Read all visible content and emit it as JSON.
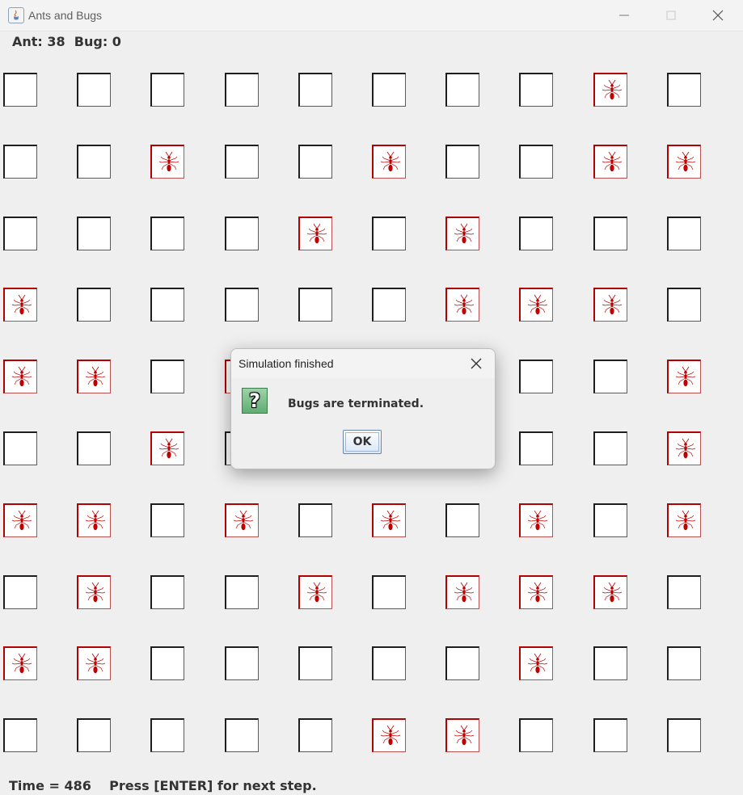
{
  "window": {
    "title": "Ants and Bugs",
    "icons": {
      "app": "java-icon",
      "minimize": "minimize-icon",
      "maximize": "maximize-icon",
      "close": "close-icon"
    }
  },
  "status": {
    "score": "Ant: 38  Bug: 0",
    "footer": "Time = 486    Press [ENTER] for next step."
  },
  "board": {
    "legend": {
      "A": "ant",
      ".": "empty"
    },
    "rows": [
      "........A.",
      "..A..A..AA",
      "....A.A...",
      "A.....AAA.",
      "AA.A.....A",
      "..A......A",
      "AA.A.A.A.A",
      ".A..A.AAA.",
      "AA.....A..",
      ".....AA..."
    ]
  },
  "dialog": {
    "title": "Simulation finished",
    "message": "Bugs are terminated.",
    "icon": "question-icon",
    "icon_glyph": "?",
    "ok_label": "OK"
  },
  "colors": {
    "ant_border": "#b30000",
    "ant": "#c00000",
    "cell_border": "#1e1e1e",
    "background": "#efefef"
  }
}
